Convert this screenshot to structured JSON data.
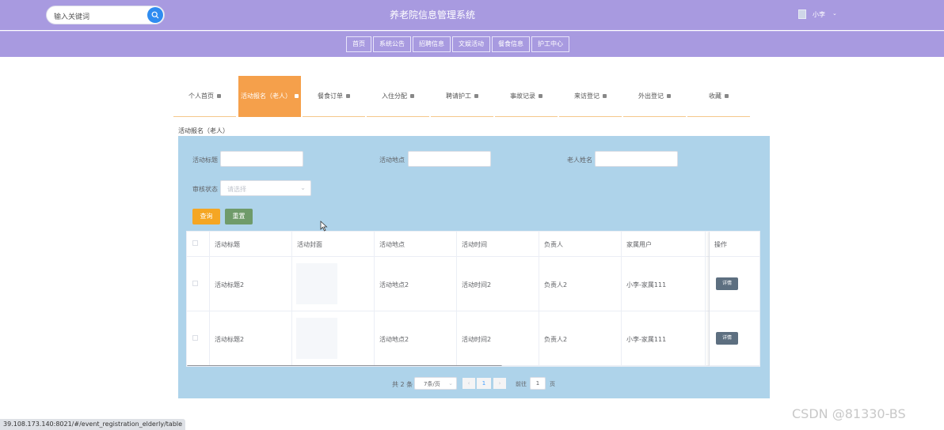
{
  "header": {
    "search_placeholder": "输入关键词",
    "title": "养老院信息管理系统",
    "user_name": "小李",
    "user_caret": "⌄"
  },
  "nav": {
    "items": [
      "首页",
      "系统公告",
      "招聘信息",
      "文娱活动",
      "餐食信息",
      "护工中心"
    ]
  },
  "subtabs": {
    "active_index": 1,
    "items": [
      "个人首页",
      "活动报名（老人）",
      "餐食订单",
      "入住分配",
      "聘请护工",
      "事故记录",
      "来访登记",
      "外出登记",
      "收藏"
    ]
  },
  "section_title": "活动报名（老人）",
  "filters": {
    "title_label": "活动标题",
    "location_label": "活动地点",
    "elder_label": "老人姓名",
    "status_label": "审核状态",
    "status_placeholder": "请选择",
    "query_button": "查询",
    "reset_button": "重置"
  },
  "table": {
    "headers": [
      "活动标题",
      "活动封面",
      "活动地点",
      "活动时间",
      "负责人",
      "家属用户",
      "操作"
    ],
    "rows": [
      {
        "title": "活动标题2",
        "location": "活动地点2",
        "time": "活动时间2",
        "manager": "负责人2",
        "family": "小李-家属111",
        "action": "详情"
      },
      {
        "title": "活动标题2",
        "location": "活动地点2",
        "time": "活动时间2",
        "manager": "负责人2",
        "family": "小李-家属111",
        "action": "详情"
      }
    ]
  },
  "pagination": {
    "total": "共 2 条",
    "page_size": "7条/页",
    "current_page": "1",
    "goto_label": "前往",
    "goto_value": "1",
    "page_unit": "页",
    "prev": "‹",
    "next": "›"
  },
  "status_bar": "39.108.173.140:8021/#/event_registration_elderly/table",
  "watermark": "CSDN @81330-BS",
  "colors": {
    "header": "#a89ae0",
    "active_tab": "#f5a04b",
    "panel": "#aed3ea",
    "query": "#f5a623",
    "reset": "#6f9b6a"
  }
}
